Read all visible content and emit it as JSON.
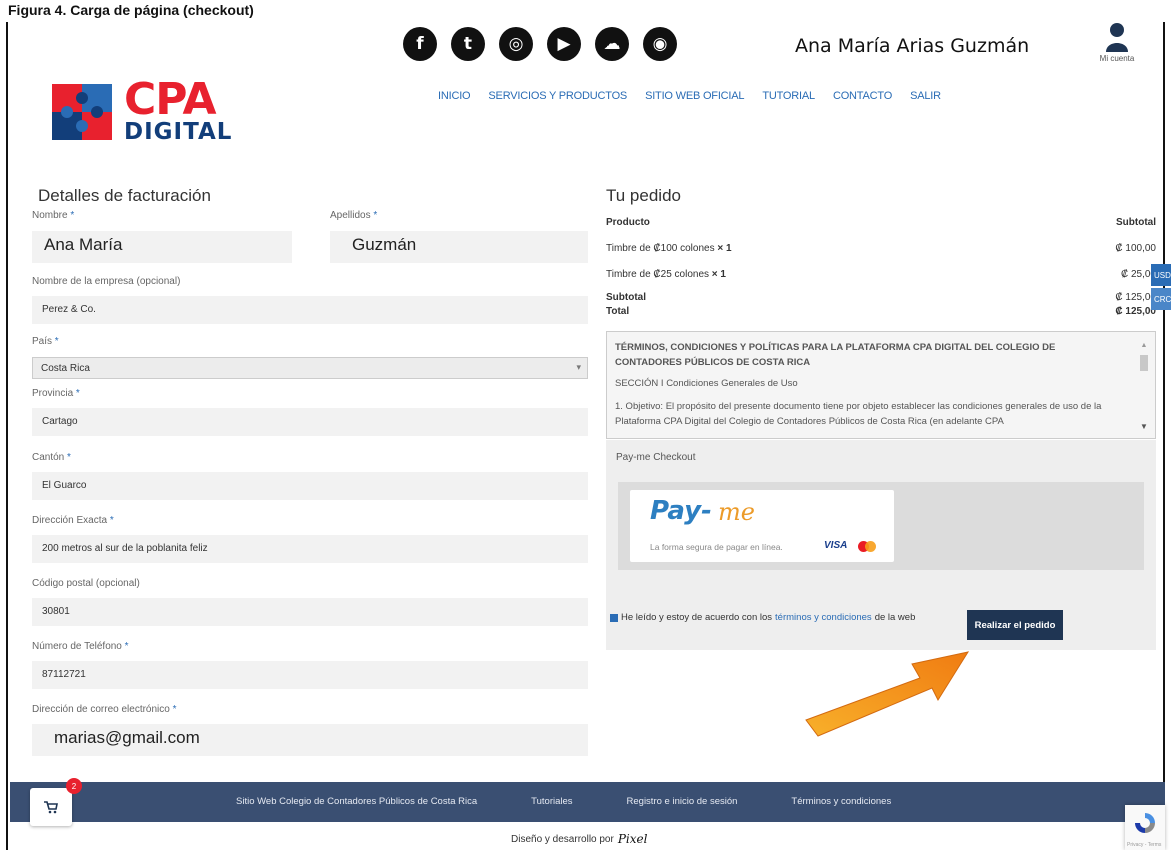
{
  "caption": "Figura 4. Carga de página (checkout)",
  "header": {
    "social_icons": [
      "facebook-icon",
      "twitter-icon",
      "instagram-icon",
      "youtube-icon",
      "soundcloud-icon",
      "flickr-icon"
    ],
    "social_glyphs": [
      "f",
      "t",
      "◎",
      "▶",
      "☁",
      "◉"
    ],
    "user_name": "Ana María Arias Guzmán",
    "account_label": "Mi cuenta",
    "logo": {
      "cpa": "CPA",
      "digital": "DIGITAL"
    },
    "nav": [
      "INICIO",
      "SERVICIOS Y PRODUCTOS",
      "SITIO WEB OFICIAL",
      "TUTORIAL",
      "CONTACTO",
      "SALIR"
    ]
  },
  "billing": {
    "title": "Detalles de facturación",
    "first_name_label": "Nombre",
    "first_name": "Ana María",
    "last_name_label": "Apellidos",
    "last_name": "Guzmán",
    "company_label": "Nombre de la empresa (opcional)",
    "company": "Perez & Co.",
    "country_label": "País",
    "country": "Costa Rica",
    "province_label": "Provincia",
    "province": "Cartago",
    "canton_label": "Cantón",
    "canton": "El Guarco",
    "address_label": "Dirección Exacta",
    "address": "200 metros al sur de la poblanita feliz",
    "postal_label": "Código postal (opcional)",
    "postal": "30801",
    "phone_label": "Número de Teléfono",
    "phone": "87112721",
    "email_label": "Dirección de correo electrónico",
    "email": "marias@gmail.com",
    "required_mark": "*"
  },
  "order": {
    "title": "Tu pedido",
    "col_product": "Producto",
    "col_subtotal": "Subtotal",
    "items": [
      {
        "name": "Timbre de ₡100 colones",
        "qty": "× 1",
        "price": "₡ 100,00"
      },
      {
        "name": "Timbre de ₡25 colones",
        "qty": "× 1",
        "price": "₡ 25,00"
      }
    ],
    "subtotal_label": "Subtotal",
    "subtotal": "₡ 125,00",
    "total_label": "Total",
    "total": "₡ 125,00"
  },
  "terms": {
    "heading": "TÉRMINOS, CONDICIONES Y POLÍTICAS PARA LA PLATAFORMA CPA DIGITAL DEL COLEGIO DE CONTADORES PÚBLICOS DE COSTA RICA",
    "section": "SECCIÓN I  Condiciones Generales de Uso",
    "paragraph": "1. Objetivo: El propósito del presente documento tiene por objeto establecer las condiciones generales de uso de la Plataforma CPA Digital del Colegio de Contadores Públicos de Costa Rica (en adelante CPA"
  },
  "payment": {
    "title": "Pay-me Checkout",
    "brand_pay": "Pay-",
    "brand_me": "me",
    "tagline": "La forma segura de pagar en línea.",
    "visa": "VISA",
    "agree_pre": "He leído y estoy de acuerdo con los",
    "agree_link": "términos y condiciones",
    "agree_post": "de la web",
    "place_order": "Realizar el pedido"
  },
  "currency": {
    "usd": "USD",
    "crc": "CRC"
  },
  "footer": {
    "links": [
      "Sitio Web Colegio de Contadores Públicos de Costa Rica",
      "Tutoriales",
      "Registro e inicio de sesión",
      "Términos y condiciones"
    ],
    "cart_count": "2",
    "credit": "Diseño y desarrollo por",
    "credit_brand": "Pixel",
    "recaptcha": "Privacy - Terms"
  },
  "colors": {
    "accent": "#2a6cb5",
    "footer": "#3a4f72",
    "button": "#1f3553",
    "brand_red": "#e8212e"
  }
}
